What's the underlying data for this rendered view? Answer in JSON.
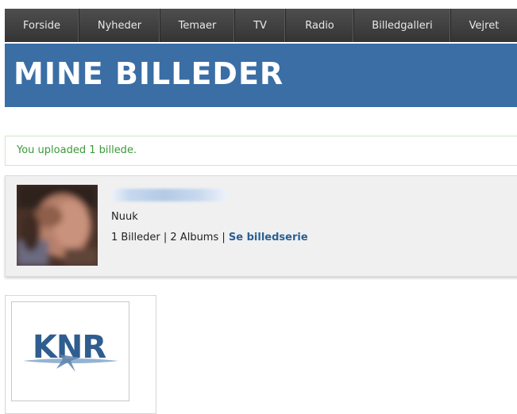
{
  "nav": {
    "items": [
      "Forside",
      "Nyheder",
      "Temaer",
      "TV",
      "Radio",
      "Billedgalleri",
      "Vejret"
    ]
  },
  "header": {
    "title": "MINE BILLEDER"
  },
  "notice": {
    "message": "You uploaded 1 billede."
  },
  "profile": {
    "location": "Nuuk",
    "images_count": "1 Billeder",
    "separator_1": " | ",
    "albums_count": "2 Albums",
    "separator_2": " | ",
    "series_link": "Se billedserie"
  },
  "thumbnail": {
    "logo_text": "KNR"
  },
  "colors": {
    "nav_bg": "#3c3c3c",
    "header_bg": "#3a6ea5",
    "notice_text": "#3a9a3a",
    "link": "#2b5f95",
    "logo_blue": "#2f5d8f"
  }
}
